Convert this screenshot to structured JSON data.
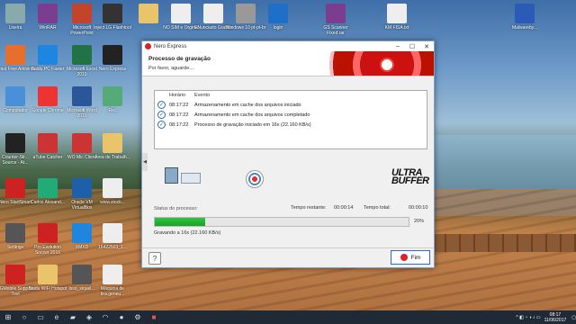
{
  "window": {
    "title": "Nero Express",
    "heading": "Processo de gravação",
    "subheading": "Por favor, aguarde....",
    "log_headers": [
      "Horário",
      "Evento"
    ],
    "log_rows": [
      {
        "time": "08:17:22",
        "event": "Armazenamento em cache dos arquivos iniciado"
      },
      {
        "time": "08:17:22",
        "event": "Armazenamento em cache dos arquivos completado"
      },
      {
        "time": "08:17:22",
        "event": "Processo de gravação iniciado em 16x (22.160 KB/s)"
      }
    ],
    "ultra_line1": "ULTRA",
    "ultra_line2": "BUFFER",
    "status_label": "Status do processo:",
    "remaining_label": "Tempo restante:",
    "remaining_value": "00:00:14",
    "total_label": "Tempo total:",
    "total_value": "00:00:10",
    "progress_percent": 20,
    "progress_text": "20%",
    "recording_text": "Gravando a 16x (22.160 KB/s)",
    "finish_button": "Fim",
    "help_label": "?"
  },
  "desktop_icons": [
    {
      "label": "Lixeira",
      "color": "#8aa"
    },
    {
      "label": "WinRAR",
      "color": "#7a3d8f"
    },
    {
      "label": "Microsoft PowerPoint",
      "color": "#c4432b"
    },
    {
      "label": "Inject LG Flashtool",
      "color": "#333"
    },
    {
      "label": "",
      "color": "#e9c46a"
    },
    {
      "label": "NO SIM e Orginal",
      "color": "#eee"
    },
    {
      "label": "ENunciado Grafica",
      "color": "#eee"
    },
    {
      "label": "Windows 10 pt-pt-br",
      "color": "#999"
    },
    {
      "label": "login",
      "color": "#1e6fc8"
    },
    {
      "label": "GS Scanner Fixed.rar",
      "color": "#7a3d8f"
    },
    {
      "label": "KM FISA.txt",
      "color": "#eee"
    },
    {
      "label": "Malwareby...",
      "color": "#2a5bb7"
    },
    {
      "label": "Avast Free Antivirus",
      "color": "#e76f2e"
    },
    {
      "label": "Baidu PC Faster",
      "color": "#1f86e0"
    },
    {
      "label": "Microsoft Excel 2010",
      "color": "#217346"
    },
    {
      "label": "Nero Express",
      "color": "#222"
    },
    {
      "label": "Computador",
      "color": "#4a90d9"
    },
    {
      "label": "Google Chrome",
      "color": "#e33"
    },
    {
      "label": "Microsoft Word 2010",
      "color": "#2b579a"
    },
    {
      "label": "Rec",
      "color": "#5a7"
    },
    {
      "label": "Counter-Str... Source - At...",
      "color": "#222"
    },
    {
      "label": "aTube Catcher",
      "color": "#c33"
    },
    {
      "label": "WO Mic Client",
      "color": "#c33"
    },
    {
      "label": "Área de Trabalh...",
      "color": "#e9c46a"
    },
    {
      "label": "Nero StartSmart",
      "color": "#c22"
    },
    {
      "label": "Carlos Alexand...",
      "color": "#2a7"
    },
    {
      "label": "Oracle VM VirtualBox",
      "color": "#1d5fa8"
    },
    {
      "label": "www.stock...",
      "color": "#eee"
    },
    {
      "label": "Settings",
      "color": "#555"
    },
    {
      "label": "Pro Evolution Soccer 2016",
      "color": "#c22"
    },
    {
      "label": "XMXD",
      "color": "#1f86e0"
    },
    {
      "label": "16422503_1...",
      "color": "#eee"
    },
    {
      "label": "LGMobile Support Tool",
      "color": "#c22"
    },
    {
      "label": "Baidu WiFi Hotspot",
      "color": "#e9c46a"
    },
    {
      "label": "Isso_siquel...",
      "color": "#555"
    },
    {
      "label": "Máquina de bra.geneu...",
      "color": "#eee"
    }
  ],
  "taskbar": {
    "time": "08:17",
    "date": "11/06/2017"
  }
}
